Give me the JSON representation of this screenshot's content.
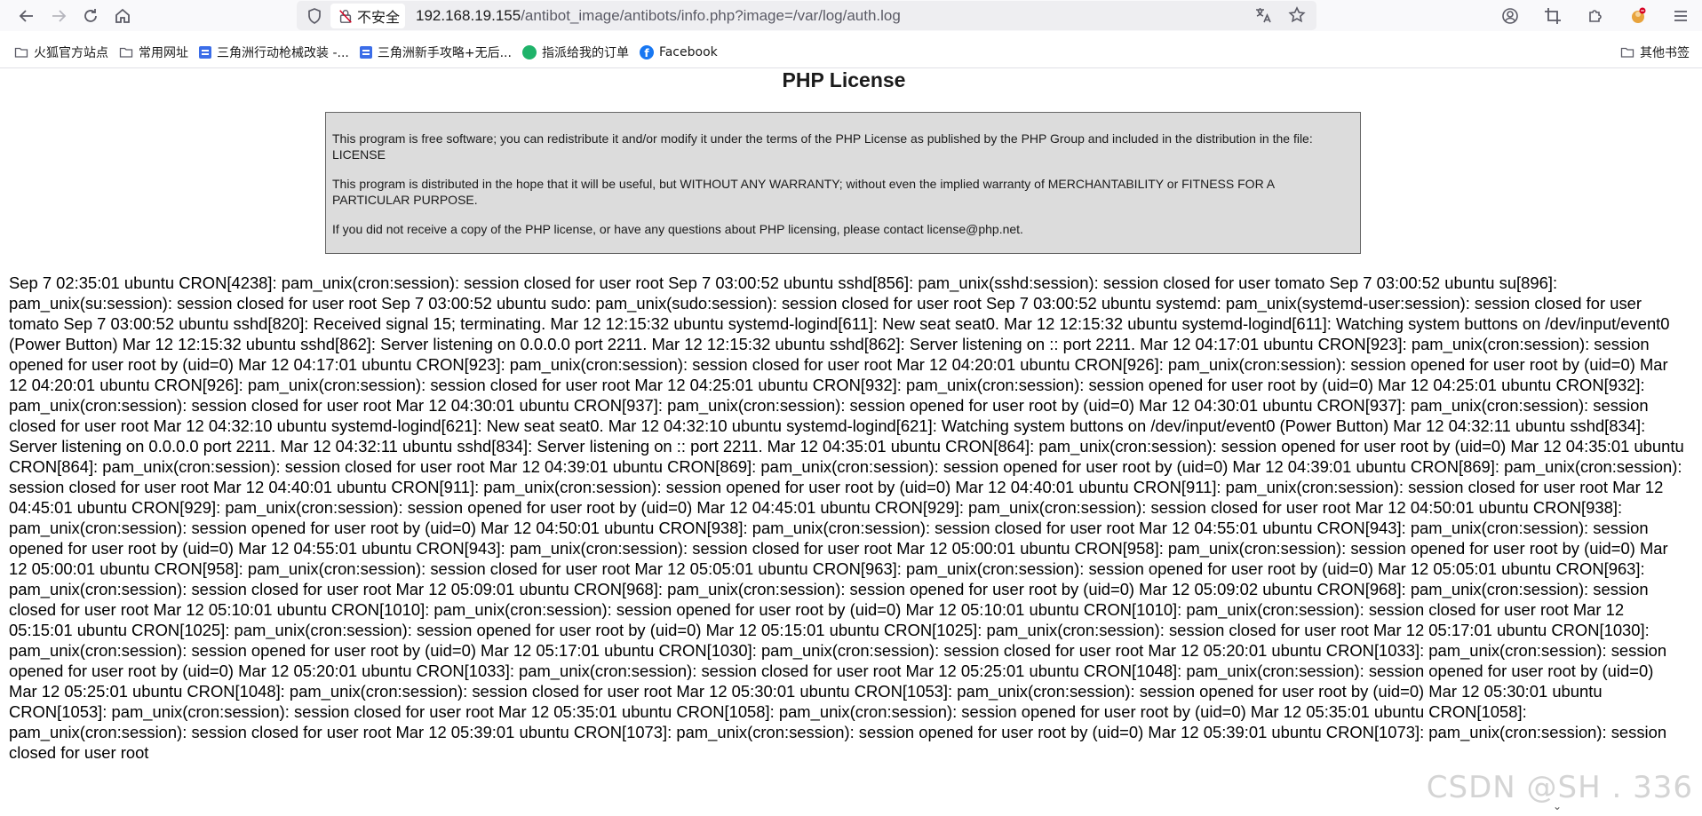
{
  "browser": {
    "security_label": "不安全",
    "url_host": "192.168.19.155",
    "url_path": "/antibot_image/antibots/info.php?image=/var/log/auth.log"
  },
  "bookmarks": {
    "items": [
      {
        "label": "火狐官方站点",
        "icon": "folder-icon"
      },
      {
        "label": "常用网址",
        "icon": "folder-icon"
      },
      {
        "label": "三角洲行动枪械改装 -...",
        "icon": "doc-icon"
      },
      {
        "label": "三角洲新手攻略+无后...",
        "icon": "doc-icon"
      },
      {
        "label": "指派给我的订单",
        "icon": "green-dot-icon"
      },
      {
        "label": "Facebook",
        "icon": "facebook-icon"
      }
    ],
    "other_label": "其他书签"
  },
  "page": {
    "title": "PHP License",
    "license_p1": "This program is free software; you can redistribute it and/or modify it under the terms of the PHP License as published by the PHP Group and included in the distribution in the file: LICENSE",
    "license_p2": "This program is distributed in the hope that it will be useful, but WITHOUT ANY WARRANTY; without even the implied warranty of MERCHANTABILITY or FITNESS FOR A PARTICULAR PURPOSE.",
    "license_p3": "If you did not receive a copy of the PHP license, or have any questions about PHP licensing, please contact license@php.net.",
    "log_text": "Sep 7 02:35:01 ubuntu CRON[4238]: pam_unix(cron:session): session closed for user root Sep 7 03:00:52 ubuntu sshd[856]: pam_unix(sshd:session): session closed for user tomato Sep 7 03:00:52 ubuntu su[896]: pam_unix(su:session): session closed for user root Sep 7 03:00:52 ubuntu sudo: pam_unix(sudo:session): session closed for user root Sep 7 03:00:52 ubuntu systemd: pam_unix(systemd-user:session): session closed for user tomato Sep 7 03:00:52 ubuntu sshd[820]: Received signal 15; terminating. Mar 12 12:15:32 ubuntu systemd-logind[611]: New seat seat0. Mar 12 12:15:32 ubuntu systemd-logind[611]: Watching system buttons on /dev/input/event0 (Power Button) Mar 12 12:15:32 ubuntu sshd[862]: Server listening on 0.0.0.0 port 2211. Mar 12 12:15:32 ubuntu sshd[862]: Server listening on :: port 2211. Mar 12 04:17:01 ubuntu CRON[923]: pam_unix(cron:session): session opened for user root by (uid=0) Mar 12 04:17:01 ubuntu CRON[923]: pam_unix(cron:session): session closed for user root Mar 12 04:20:01 ubuntu CRON[926]: pam_unix(cron:session): session opened for user root by (uid=0) Mar 12 04:20:01 ubuntu CRON[926]: pam_unix(cron:session): session closed for user root Mar 12 04:25:01 ubuntu CRON[932]: pam_unix(cron:session): session opened for user root by (uid=0) Mar 12 04:25:01 ubuntu CRON[932]: pam_unix(cron:session): session closed for user root Mar 12 04:30:01 ubuntu CRON[937]: pam_unix(cron:session): session opened for user root by (uid=0) Mar 12 04:30:01 ubuntu CRON[937]: pam_unix(cron:session): session closed for user root Mar 12 04:32:10 ubuntu systemd-logind[621]: New seat seat0. Mar 12 04:32:10 ubuntu systemd-logind[621]: Watching system buttons on /dev/input/event0 (Power Button) Mar 12 04:32:11 ubuntu sshd[834]: Server listening on 0.0.0.0 port 2211. Mar 12 04:32:11 ubuntu sshd[834]: Server listening on :: port 2211. Mar 12 04:35:01 ubuntu CRON[864]: pam_unix(cron:session): session opened for user root by (uid=0) Mar 12 04:35:01 ubuntu CRON[864]: pam_unix(cron:session): session closed for user root Mar 12 04:39:01 ubuntu CRON[869]: pam_unix(cron:session): session opened for user root by (uid=0) Mar 12 04:39:01 ubuntu CRON[869]: pam_unix(cron:session): session closed for user root Mar 12 04:40:01 ubuntu CRON[911]: pam_unix(cron:session): session opened for user root by (uid=0) Mar 12 04:40:01 ubuntu CRON[911]: pam_unix(cron:session): session closed for user root Mar 12 04:45:01 ubuntu CRON[929]: pam_unix(cron:session): session opened for user root by (uid=0) Mar 12 04:45:01 ubuntu CRON[929]: pam_unix(cron:session): session closed for user root Mar 12 04:50:01 ubuntu CRON[938]: pam_unix(cron:session): session opened for user root by (uid=0) Mar 12 04:50:01 ubuntu CRON[938]: pam_unix(cron:session): session closed for user root Mar 12 04:55:01 ubuntu CRON[943]: pam_unix(cron:session): session opened for user root by (uid=0) Mar 12 04:55:01 ubuntu CRON[943]: pam_unix(cron:session): session closed for user root Mar 12 05:00:01 ubuntu CRON[958]: pam_unix(cron:session): session opened for user root by (uid=0) Mar 12 05:00:01 ubuntu CRON[958]: pam_unix(cron:session): session closed for user root Mar 12 05:05:01 ubuntu CRON[963]: pam_unix(cron:session): session opened for user root by (uid=0) Mar 12 05:05:01 ubuntu CRON[963]: pam_unix(cron:session): session closed for user root Mar 12 05:09:01 ubuntu CRON[968]: pam_unix(cron:session): session opened for user root by (uid=0) Mar 12 05:09:02 ubuntu CRON[968]: pam_unix(cron:session): session closed for user root Mar 12 05:10:01 ubuntu CRON[1010]: pam_unix(cron:session): session opened for user root by (uid=0) Mar 12 05:10:01 ubuntu CRON[1010]: pam_unix(cron:session): session closed for user root Mar 12 05:15:01 ubuntu CRON[1025]: pam_unix(cron:session): session opened for user root by (uid=0) Mar 12 05:15:01 ubuntu CRON[1025]: pam_unix(cron:session): session closed for user root Mar 12 05:17:01 ubuntu CRON[1030]: pam_unix(cron:session): session opened for user root by (uid=0) Mar 12 05:17:01 ubuntu CRON[1030]: pam_unix(cron:session): session closed for user root Mar 12 05:20:01 ubuntu CRON[1033]: pam_unix(cron:session): session opened for user root by (uid=0) Mar 12 05:20:01 ubuntu CRON[1033]: pam_unix(cron:session): session closed for user root Mar 12 05:25:01 ubuntu CRON[1048]: pam_unix(cron:session): session opened for user root by (uid=0) Mar 12 05:25:01 ubuntu CRON[1048]: pam_unix(cron:session): session closed for user root Mar 12 05:30:01 ubuntu CRON[1053]: pam_unix(cron:session): session opened for user root by (uid=0) Mar 12 05:30:01 ubuntu CRON[1053]: pam_unix(cron:session): session closed for user root Mar 12 05:35:01 ubuntu CRON[1058]: pam_unix(cron:session): session opened for user root by (uid=0) Mar 12 05:35:01 ubuntu CRON[1058]: pam_unix(cron:session): session closed for user root Mar 12 05:39:01 ubuntu CRON[1073]: pam_unix(cron:session): session opened for user root by (uid=0) Mar 12 05:39:01 ubuntu CRON[1073]: pam_unix(cron:session): session closed for user root"
  },
  "watermark": "CSDN @SH      . 336"
}
